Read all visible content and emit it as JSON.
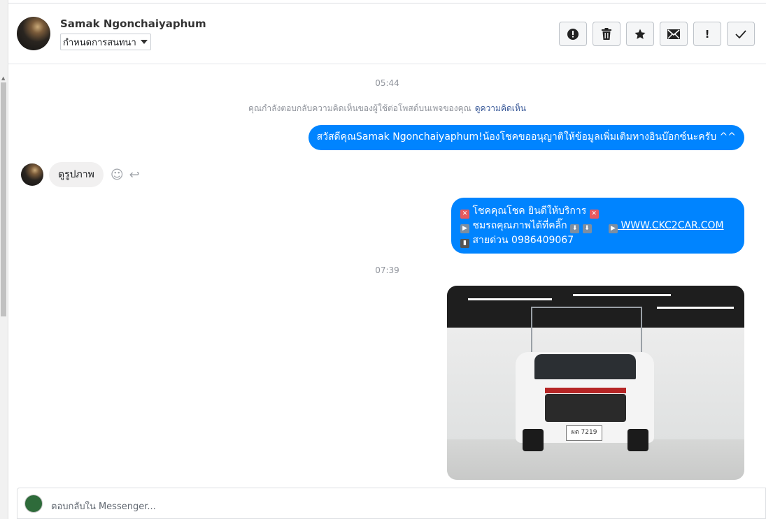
{
  "header": {
    "contact_name": "Samak Ngonchaiyaphum",
    "assign_label": "กำหนดการสนทนา",
    "actions": [
      {
        "icon": "alert-circle-icon",
        "glyph": "!"
      },
      {
        "icon": "trash-icon",
        "glyph": "🗑"
      },
      {
        "icon": "star-icon",
        "glyph": "★"
      },
      {
        "icon": "envelope-icon",
        "glyph": "✉"
      },
      {
        "icon": "exclamation-icon",
        "glyph": "!"
      },
      {
        "icon": "checkmark-icon",
        "glyph": "✓"
      }
    ]
  },
  "conversation": {
    "time_1": "05:44",
    "system_note": "คุณกำลังตอบกลับความคิดเห็นของผู้ใช้ต่อโพสต์บนเพจของคุณ",
    "system_note_link": "ดูความคิดเห็น",
    "message_out_1": "สวัสดีคุณSamak Ngonchaiyaphum!น้องโชคขออนุญาติให้ข้อมูลเพิ่มเติมทางอินบ๊อกซ์นะครับ ^^",
    "message_in_1": "ดูรูปภาพ",
    "message_out_2": {
      "line1": "โชคคุณโชค ยินดีให้บริการ",
      "line2": "ชมรถคุณภาพได้ที่คลิ๊ก",
      "url": "WWW.CKC2CAR.COM",
      "line3": "สายด่วน 0986409067"
    },
    "time_2": "07:39",
    "photo_plate": "ผต 7219"
  },
  "composer": {
    "placeholder": "ตอบกลับใน Messenger..."
  }
}
